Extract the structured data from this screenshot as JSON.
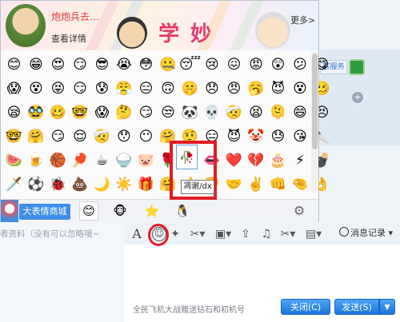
{
  "banner": {
    "title": "炮炮兵去…",
    "link": "查看详情",
    "more": "更多>",
    "big_text": "学妙"
  },
  "emoji_rows": [
    [
      "😊",
      "😁",
      "😍",
      "😏",
      "😎",
      "😭",
      "😳",
      "🤐",
      "😴",
      "😢",
      "😖",
      "😡",
      "😲",
      "😕",
      "😋"
    ],
    [
      "😱",
      "😵",
      "😝",
      "😏",
      "😰",
      "😤",
      "😑",
      "🙃",
      "🤫",
      "😞",
      "😠",
      "🥱",
      "😈",
      "😵",
      "🥴"
    ],
    [
      "😪",
      "🥸",
      "🥴",
      "🤓",
      "😱",
      "🤔",
      "😏",
      "😒",
      "🐼",
      "💀",
      "🤕",
      "😫",
      "🫠",
      "😄",
      "😣"
    ],
    [
      "🤓",
      "🤗",
      "😏",
      "😌",
      "🤕",
      "😯",
      "😶",
      "🤗",
      "🤨",
      "😑",
      "😈",
      "🤡",
      "😓",
      "😘",
      "🔪"
    ],
    [
      "🍉",
      "🍺",
      "🏀",
      "🏓",
      "☕",
      "🍚",
      "🐷",
      "🌹",
      "🥀",
      "👄",
      "❤️",
      "💔",
      "🎂",
      "⚡",
      "💣"
    ],
    [
      "🗡️",
      "⚽",
      "🐞",
      "💩",
      "🌙",
      "☀️",
      "🎁",
      "🤗",
      "👍",
      "👎",
      "🤝",
      "✌️",
      "👊",
      "🤏",
      "👌"
    ]
  ],
  "tooltip": "凋谢/dx",
  "store_button": "大表情商城",
  "tabs": [
    "😊",
    "🐵",
    "⭐",
    "🐧"
  ],
  "right_panel": {
    "service_label": "客服务"
  },
  "profile_hint": "者资料（没有可以忽略哦~",
  "toolbar": {
    "font_icon": "A",
    "history_label": "消息记录"
  },
  "ad_line": "全民飞机大战赠送钻石和初机号",
  "buttons": {
    "close": "关闭(C)",
    "send": "发送(S)",
    "send_arrow": "▼"
  },
  "colors": {
    "highlight_red": "#e21b23",
    "button_blue": "#1a76d8"
  }
}
